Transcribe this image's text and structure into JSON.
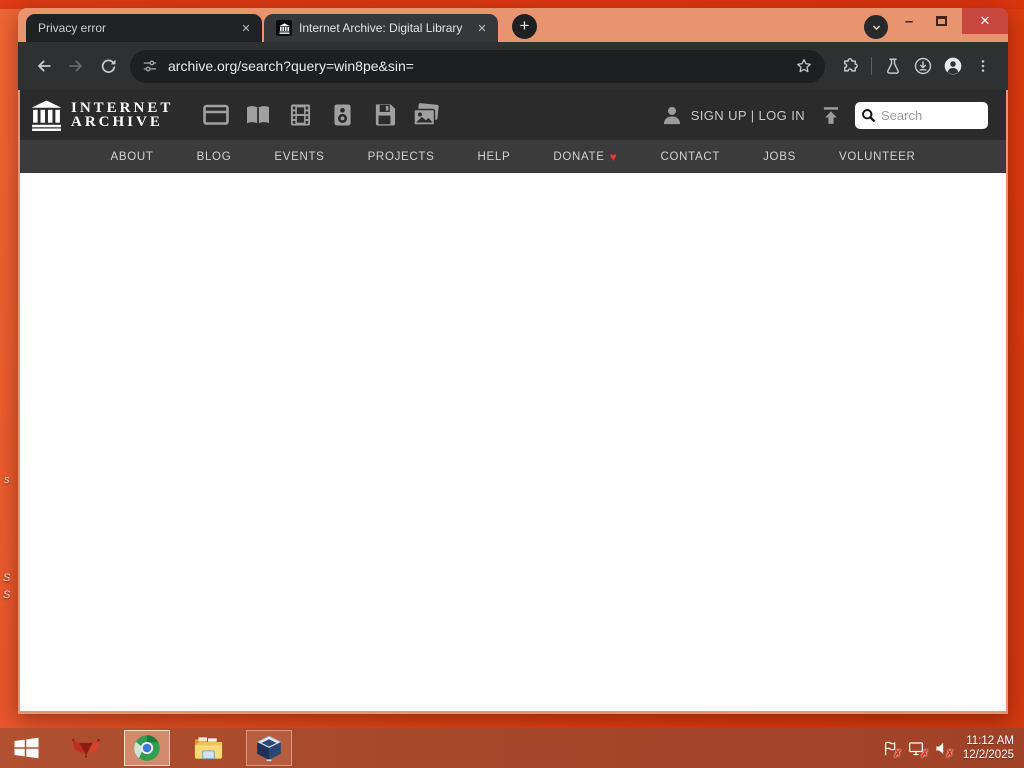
{
  "browser": {
    "tabs": [
      {
        "title": "Privacy error",
        "active": false
      },
      {
        "title": "Internet Archive: Digital Library",
        "active": true
      }
    ],
    "url": "archive.org/search?query=win8pe&sin="
  },
  "archive": {
    "brand_line1": "INTERNET",
    "brand_line2": "ARCHIVE",
    "media_types": [
      "web",
      "texts",
      "video",
      "audio",
      "software",
      "images"
    ],
    "signup_login": "SIGN UP | LOG IN",
    "search_placeholder": "Search",
    "nav": [
      "ABOUT",
      "BLOG",
      "EVENTS",
      "PROJECTS",
      "HELP",
      "DONATE",
      "CONTACT",
      "JOBS",
      "VOLUNTEER"
    ]
  },
  "taskbar": {
    "time": "11:12 AM",
    "date": "12/2/2025"
  },
  "desktop": {
    "icon_label_fragments": [
      "S",
      "S",
      "s"
    ]
  },
  "icons": {
    "close_x": "✕",
    "plus": "+",
    "minimize": "–",
    "donate_heart": "♥"
  },
  "colors": {
    "frame_salmon": "#e8946e",
    "close_button_red": "#c8473f",
    "toolbar_dark": "#2f3032",
    "ia_header": "#2b2b2b",
    "ia_nav_bar": "#3b3b3b",
    "donate_heart": "#e8352b",
    "desktop_orange_red": "#e04413",
    "taskbar_brown_red": "#a54729"
  }
}
